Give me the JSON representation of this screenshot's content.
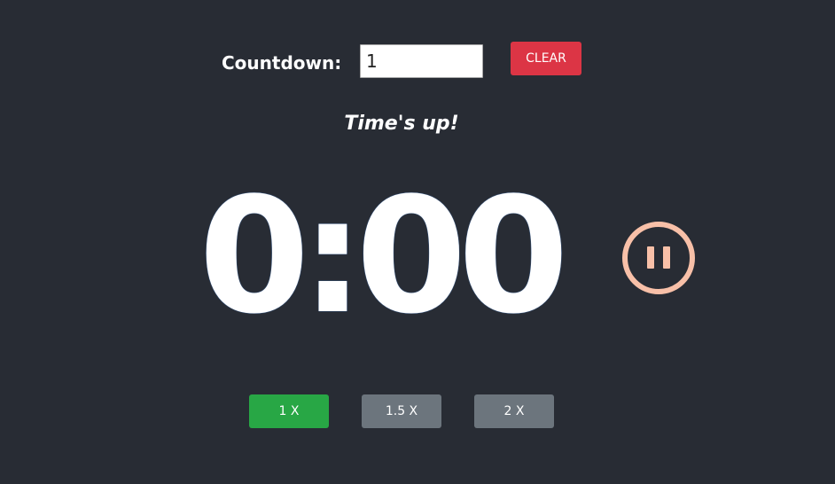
{
  "countdown": {
    "label": "Countdown:",
    "input_value": "1",
    "clear_label": "CLEAR"
  },
  "status": {
    "message": "Time's up!"
  },
  "timer": {
    "display": "0:00"
  },
  "controls": {
    "pause_icon": "pause-icon",
    "pause_color": "#f8c0a8"
  },
  "speeds": {
    "buttons": [
      {
        "label": "1 X",
        "active": true
      },
      {
        "label": "1.5 X",
        "active": false
      },
      {
        "label": "2 X",
        "active": false
      }
    ],
    "active_color": "#28a745",
    "inactive_color": "#6c757d"
  },
  "theme": {
    "background": "#282c34",
    "danger_color": "#dc3545"
  }
}
